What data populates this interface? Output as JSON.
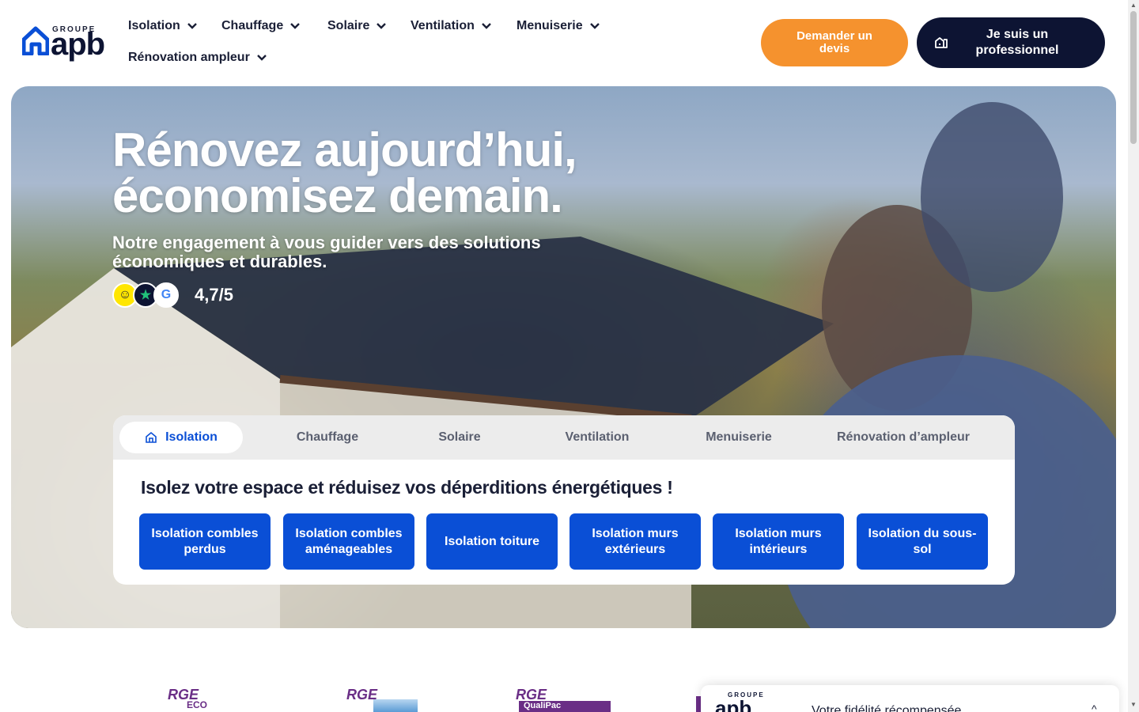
{
  "header": {
    "logo_small": "GROUPE",
    "logo_big": "apb",
    "nav": [
      {
        "label": "Isolation"
      },
      {
        "label": "Chauffage"
      },
      {
        "label": "Solaire"
      },
      {
        "label": "Ventilation"
      },
      {
        "label": "Menuiserie"
      },
      {
        "label": "Rénovation ampleur"
      }
    ],
    "cta_quote": "Demander un devis",
    "cta_pro": "Je suis un professionnel"
  },
  "hero": {
    "title_line1": "Rénovez aujourd’hui,",
    "title_line2": "économisez demain.",
    "subtitle": "Notre engagement à vous guider vers des solutions économiques et durables.",
    "rating": "4,7/5"
  },
  "services": {
    "tabs": [
      {
        "label": "Isolation",
        "active": true
      },
      {
        "label": "Chauffage"
      },
      {
        "label": "Solaire"
      },
      {
        "label": "Ventilation"
      },
      {
        "label": "Menuiserie"
      },
      {
        "label": "Rénovation d’ampleur"
      }
    ],
    "heading": "Isolez votre espace et réduisez vos déperditions énergétiques !",
    "buttons": [
      {
        "label": "Isolation combles perdus"
      },
      {
        "label": "Isolation combles aménageables"
      },
      {
        "label": "Isolation toiture"
      },
      {
        "label": "Isolation murs extérieurs"
      },
      {
        "label": "Isolation murs intérieurs"
      },
      {
        "label": "Isolation du sous-sol"
      }
    ]
  },
  "certifications": {
    "rge1": "RGE",
    "rge1_sub": "ECO",
    "rge2": "RGE",
    "rge3": "RGE",
    "rge3_sub": "QualiPac"
  },
  "banner": {
    "logo_small": "GROUPE",
    "logo_big": "apb",
    "text": "Votre fidélité récompensée",
    "toggle": "^"
  },
  "colors": {
    "accent_orange": "#f5922e",
    "navy": "#0d1433",
    "primary_blue": "#0a4fd6"
  }
}
